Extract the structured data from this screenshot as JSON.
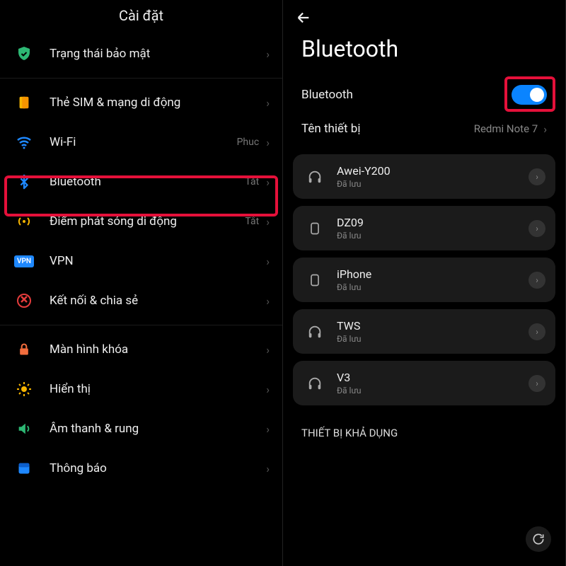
{
  "left": {
    "title": "Cài đặt",
    "items": [
      {
        "id": "security-status",
        "label": "Trạng thái bảo mật",
        "value": "",
        "icon": "shield-check-icon",
        "color": "#2db874"
      },
      {
        "id": "sim",
        "label": "Thẻ SIM & mạng di động",
        "value": "",
        "icon": "sim-icon",
        "color": "#f7b500"
      },
      {
        "id": "wifi",
        "label": "Wi-Fi",
        "value": "Phuc",
        "icon": "wifi-icon",
        "color": "#1e88ff"
      },
      {
        "id": "bluetooth",
        "label": "Bluetooth",
        "value": "Tắt",
        "icon": "bluetooth-icon",
        "color": "#1e88ff"
      },
      {
        "id": "hotspot",
        "label": "Điểm phát sóng di động",
        "value": "Tắt",
        "icon": "hotspot-icon",
        "color": "#f7b500"
      },
      {
        "id": "vpn",
        "label": "VPN",
        "value": "",
        "icon": "vpn-icon",
        "color": "#1e88ff"
      },
      {
        "id": "share",
        "label": "Kết nối & chia sẻ",
        "value": "",
        "icon": "share-icon",
        "color": "#e53c3c"
      },
      {
        "id": "lockscreen",
        "label": "Màn hình khóa",
        "value": "",
        "icon": "lock-icon",
        "color": "#f26d3d"
      },
      {
        "id": "display",
        "label": "Hiển thị",
        "value": "",
        "icon": "sun-icon",
        "color": "#f7b500"
      },
      {
        "id": "sound",
        "label": "Âm thanh & rung",
        "value": "",
        "icon": "speaker-icon",
        "color": "#2db874"
      },
      {
        "id": "notifications",
        "label": "Thông báo",
        "value": "",
        "icon": "notification-icon",
        "color": "#1e88ff"
      }
    ]
  },
  "right": {
    "title": "Bluetooth",
    "toggle_label": "Bluetooth",
    "toggle_on": true,
    "device_name_label": "Tên thiết bị",
    "device_name_value": "Redmi Note 7",
    "devices": [
      {
        "name": "Awei-Y200",
        "status": "Đã lưu",
        "type": "headphones"
      },
      {
        "name": "DZ09",
        "status": "Đã lưu",
        "type": "phone"
      },
      {
        "name": "iPhone",
        "status": "Đã lưu",
        "type": "phone"
      },
      {
        "name": "TWS",
        "status": "Đã lưu",
        "type": "headphones"
      },
      {
        "name": "V3",
        "status": "Đã lưu",
        "type": "headphones"
      }
    ],
    "available_label": "THIẾT BỊ KHẢ DỤNG"
  }
}
